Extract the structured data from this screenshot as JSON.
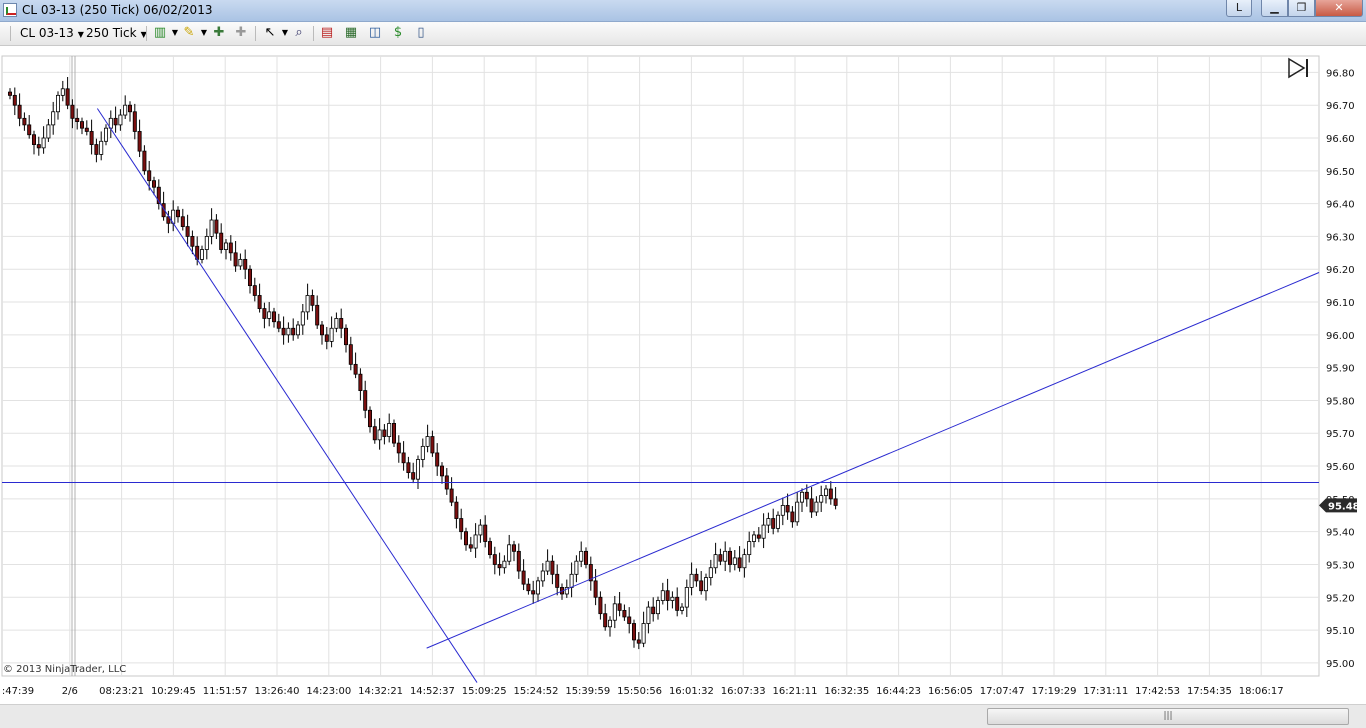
{
  "window": {
    "title": "CL 03-13 (250 Tick)  06/02/2013",
    "buttons": {
      "link": "L",
      "minimize": "▁",
      "maximize": "❐",
      "close": "✕"
    }
  },
  "toolbar": {
    "instrument": "CL 03-13",
    "interval": "250 Tick"
  },
  "chart": {
    "copyright": "© 2013 NinjaTrader, LLC",
    "price_axis_labels": [
      "96.80",
      "96.70",
      "96.60",
      "96.50",
      "96.40",
      "96.30",
      "96.20",
      "96.10",
      "96.00",
      "95.90",
      "95.80",
      "95.70",
      "95.60",
      "95.50",
      "95.40",
      "95.30",
      "95.20",
      "95.10",
      "95.00"
    ],
    "current_price": "95.48",
    "time_axis_labels": [
      ":47:39",
      "2/6",
      "08:23:21",
      "10:29:45",
      "11:51:57",
      "13:26:40",
      "14:23:00",
      "14:32:21",
      "14:52:37",
      "15:09:25",
      "15:24:52",
      "15:39:59",
      "15:50:56",
      "16:01:32",
      "16:07:33",
      "16:21:11",
      "16:32:35",
      "16:44:23",
      "16:56:05",
      "17:07:47",
      "17:19:29",
      "17:31:11",
      "17:42:53",
      "17:54:35",
      "18:06:17"
    ],
    "colors": {
      "up_candle": "#ffffff",
      "down_candle": "#7a1010",
      "wick": "#000000",
      "drawing_lines": "#2a2ad0",
      "grid": "#e2e2e2",
      "price_marker": "#2b2b2b"
    }
  },
  "chart_data": {
    "type": "candlestick",
    "y_range": [
      94.96,
      96.85
    ],
    "x_range": [
      0,
      255
    ],
    "drawings": {
      "horizontal_line": {
        "price": 95.55
      },
      "down_trendline": {
        "start": {
          "x": 26,
          "price": 96.69
        },
        "end": {
          "x": 139,
          "price": 94.94
        }
      },
      "up_trendline": {
        "start": {
          "x": 124,
          "price": 95.045
        },
        "end": {
          "x": 255,
          "price": 96.19
        }
      }
    },
    "closes": [
      96.73,
      96.7,
      96.66,
      96.64,
      96.61,
      96.58,
      96.57,
      96.6,
      96.64,
      96.68,
      96.73,
      96.75,
      96.7,
      96.66,
      96.65,
      96.63,
      96.62,
      96.58,
      96.55,
      96.59,
      96.63,
      96.66,
      96.64,
      96.67,
      96.7,
      96.68,
      96.62,
      96.56,
      96.5,
      96.47,
      96.45,
      96.4,
      96.36,
      96.34,
      96.38,
      96.36,
      96.33,
      96.3,
      96.27,
      96.23,
      96.26,
      96.3,
      96.35,
      96.31,
      96.26,
      96.28,
      96.25,
      96.21,
      96.23,
      96.2,
      96.15,
      96.12,
      96.08,
      96.05,
      96.07,
      96.04,
      96.02,
      96.0,
      96.02,
      96.0,
      96.03,
      96.07,
      96.12,
      96.09,
      96.03,
      96.0,
      95.98,
      96.02,
      96.05,
      96.02,
      95.97,
      95.91,
      95.88,
      95.83,
      95.77,
      95.72,
      95.68,
      95.71,
      95.69,
      95.73,
      95.67,
      95.64,
      95.61,
      95.58,
      95.56,
      95.62,
      95.66,
      95.69,
      95.64,
      95.6,
      95.57,
      95.53,
      95.49,
      95.44,
      95.4,
      95.36,
      95.35,
      95.39,
      95.42,
      95.37,
      95.33,
      95.3,
      95.29,
      95.31,
      95.36,
      95.34,
      95.28,
      95.24,
      95.22,
      95.21,
      95.25,
      95.28,
      95.31,
      95.27,
      95.23,
      95.21,
      95.23,
      95.27,
      95.31,
      95.34,
      95.3,
      95.25,
      95.2,
      95.15,
      95.11,
      95.13,
      95.18,
      95.16,
      95.14,
      95.12,
      95.07,
      95.06,
      95.12,
      95.17,
      95.15,
      95.19,
      95.22,
      95.19,
      95.2,
      95.16,
      95.17,
      95.23,
      95.27,
      95.25,
      95.22,
      95.26,
      95.29,
      95.33,
      95.31,
      95.34,
      95.3,
      95.32,
      95.29,
      95.33,
      95.37,
      95.39,
      95.38,
      95.42,
      95.44,
      95.41,
      95.45,
      95.48,
      95.46,
      95.43,
      95.49,
      95.52,
      95.5,
      95.46,
      95.49,
      95.51,
      95.53,
      95.5,
      95.48
    ],
    "notes": "OHLC series; wick extents are derived from closes with small offsets for a tick-chart appearance"
  }
}
